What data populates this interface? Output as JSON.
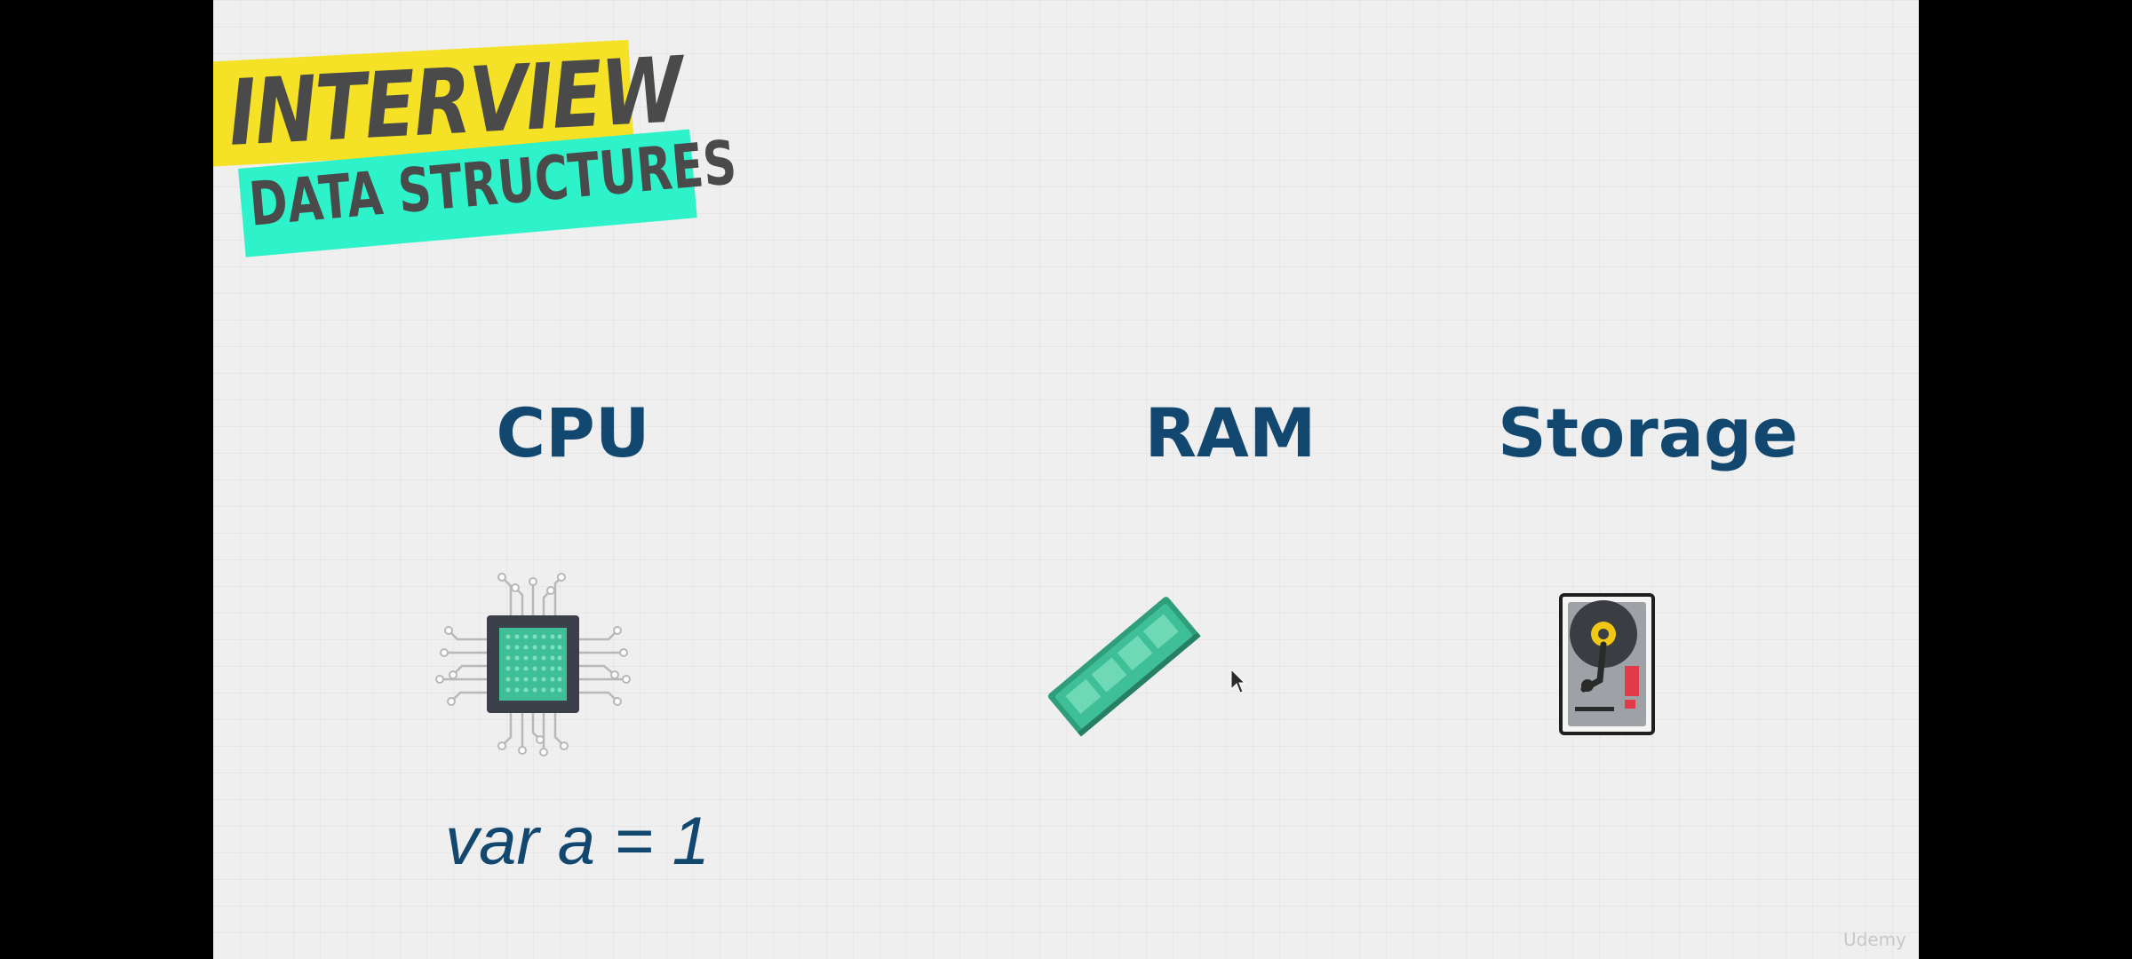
{
  "badge": {
    "title": "INTERVIEW",
    "subtitle": "DATA STRUCTURES",
    "colors": {
      "yellow": "#f5e227",
      "green": "#2ef2c9",
      "text": "#4a4a4a"
    }
  },
  "columns": {
    "cpu": {
      "label": "CPU",
      "icon": "cpu-chip-icon"
    },
    "ram": {
      "label": "RAM",
      "icon": "ram-stick-icon"
    },
    "storage": {
      "label": "Storage",
      "icon": "hard-drive-icon"
    }
  },
  "code": {
    "text": "var a = 1"
  },
  "watermark": "Udemy",
  "colors": {
    "label": "#124870",
    "background": "#efefef",
    "letterbox": "#000000"
  }
}
